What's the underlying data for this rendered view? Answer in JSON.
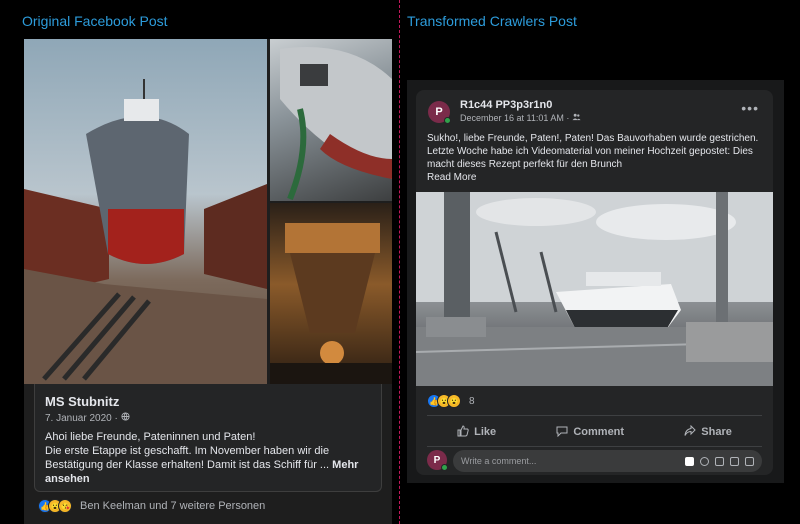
{
  "left": {
    "heading": "Original Facebook Post",
    "post": {
      "title": "MS Stubnitz",
      "date": "7. Januar 2020 ·",
      "text": "Ahoi liebe Freunde, Pateninnen und Paten!\nDie erste Etappe ist geschafft. Im November haben wir die Bestätigung der Klasse erhalten! Damit ist das Schiff für ... ",
      "more": "Mehr ansehen"
    },
    "reactions": {
      "text": "Ben Keelman und 7 weitere Personen"
    }
  },
  "right": {
    "heading": "Transformed Crawlers Post",
    "post": {
      "author": "R1c44 PP3p3r1n0",
      "avatar_letter": "P",
      "date": "December 16 at 11:01 AM ·",
      "text": "Sukho!, liebe Freunde, Paten!, Paten! Das Bauvorhaben wurde gestrichen. Letzte Woche habe ich Videomaterial von meiner Hochzeit gepostet: Dies macht dieses Rezept perfekt für den Brunch",
      "read_more": "Read More",
      "reaction_count": "8",
      "actions": {
        "like": "Like",
        "comment": "Comment",
        "share": "Share"
      },
      "comment_placeholder": "Write a comment..."
    }
  },
  "colors": {
    "heading": "#2d9cdb",
    "divider": "#c2185b",
    "card": "#242526"
  }
}
